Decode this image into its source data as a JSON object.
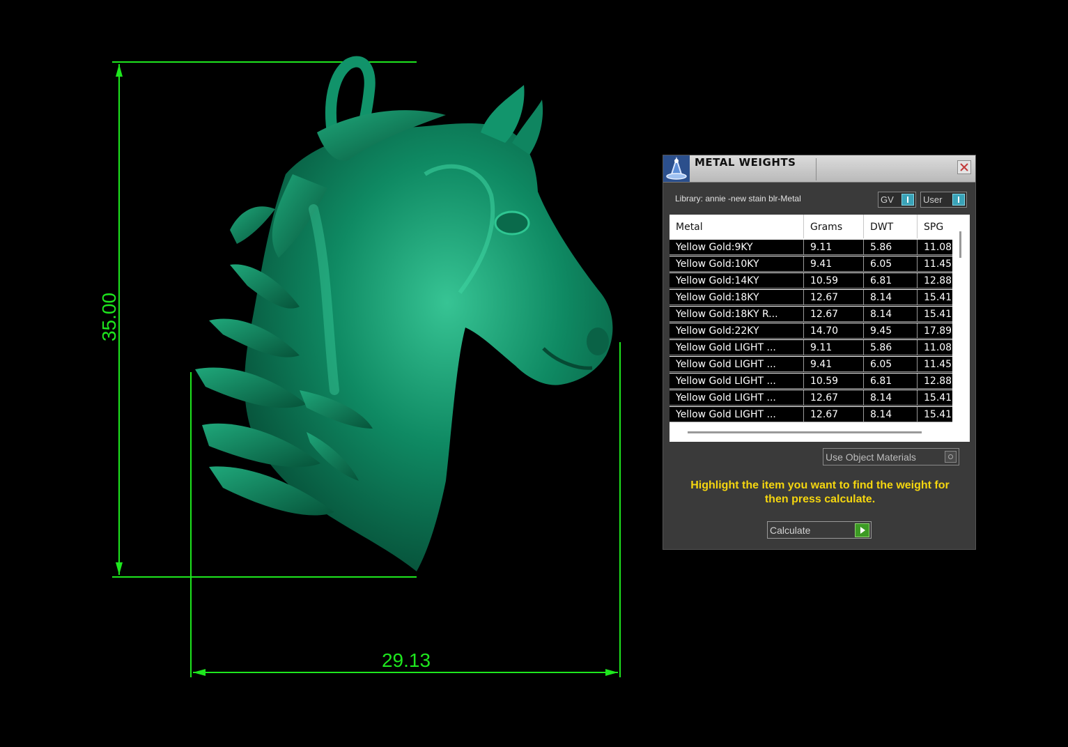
{
  "dimensions": {
    "height": "35.00",
    "width": "29.13"
  },
  "colors": {
    "background": "#000000",
    "dimension_lines": "#1ee61e",
    "model": "#0e7f5c",
    "panel": "#3a3a3a",
    "instruction_text": "#f5d60f",
    "calculate_accent": "#3c9a24"
  },
  "model": {
    "subject": "horse-head pendant",
    "icon": "horse-head-model"
  },
  "panel": {
    "title": "METAL WEIGHTS",
    "close_icon": "close-icon",
    "library": "Library: annie -new stain blr-Metal",
    "toggles": [
      {
        "label": "GV"
      },
      {
        "label": "User"
      }
    ],
    "table": {
      "headers": [
        "Metal",
        "Grams",
        "DWT",
        "SPG"
      ],
      "rows": [
        [
          "Yellow Gold:9KY",
          "9.11",
          "5.86",
          "11.08"
        ],
        [
          "Yellow Gold:10KY",
          "9.41",
          "6.05",
          "11.45"
        ],
        [
          "Yellow Gold:14KY",
          "10.59",
          "6.81",
          "12.88"
        ],
        [
          "Yellow Gold:18KY",
          "12.67",
          "8.14",
          "15.41"
        ],
        [
          "Yellow Gold:18KY R...",
          "12.67",
          "8.14",
          "15.41"
        ],
        [
          "Yellow Gold:22KY",
          "14.70",
          "9.45",
          "17.89"
        ],
        [
          "Yellow Gold LIGHT ...",
          "9.11",
          "5.86",
          "11.08"
        ],
        [
          "Yellow Gold LIGHT ...",
          "9.41",
          "6.05",
          "11.45"
        ],
        [
          "Yellow Gold LIGHT ...",
          "10.59",
          "6.81",
          "12.88"
        ],
        [
          "Yellow Gold LIGHT ...",
          "12.67",
          "8.14",
          "15.41"
        ],
        [
          "Yellow Gold LIGHT ...",
          "12.67",
          "8.14",
          "15.41"
        ]
      ]
    },
    "use_object_materials": "Use Object Materials",
    "instruction": "Highlight the item you want to find the weight for then press calculate.",
    "calculate": "Calculate"
  }
}
